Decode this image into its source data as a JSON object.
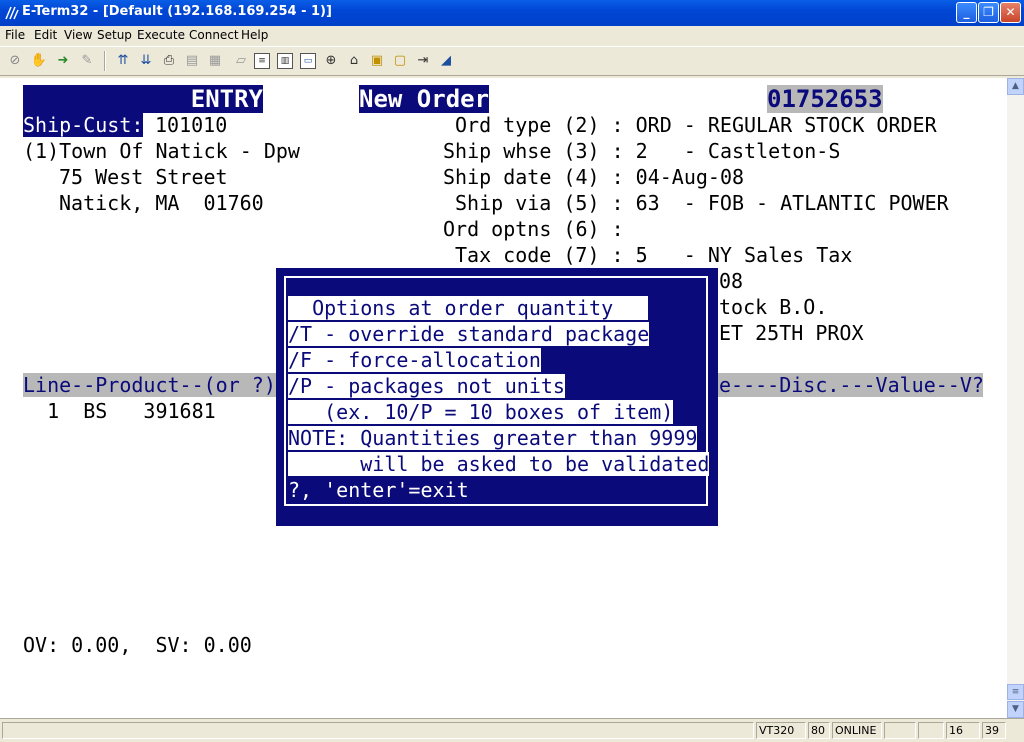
{
  "window": {
    "title": "E-Term32 - [Default (192.168.169.254 - 1)]"
  },
  "menu": [
    "File",
    "Edit",
    "View",
    "Setup",
    "Execute",
    "Connect",
    "Help"
  ],
  "toolbar": {
    "icons": [
      "disconnect-icon",
      "hand-icon",
      "connect-icon",
      "stamp-icon",
      "upload-icon",
      "download-icon",
      "print-icon",
      "copy-icon",
      "paste-icon",
      "clear-icon",
      "list-icon",
      "columns-icon",
      "keyboard-icon",
      "crosshair-icon",
      "macro-icon",
      "folder-icon",
      "script-icon",
      "exit-icon",
      "pen-icon"
    ]
  },
  "terminal": {
    "entry_label": "ENTRY",
    "new_order_label": "New Order",
    "order_number": "01752653",
    "ship_cust_label": "Ship-Cust:",
    "ship_cust_value": "101010",
    "cust_name": "(1)Town Of Natick - Dpw",
    "cust_addr1": "75 West Street",
    "cust_addr2": "Natick, MA  01760",
    "fields": [
      "Ord type (2) : ORD - REGULAR STOCK ORDER",
      "Ship whse (3) : 2   - Castleton-S",
      "Ship date (4) : 04-Aug-08",
      "Ship via (5) : 63  - FOB - ATLANTIC POWER",
      "Ord optns (6) :",
      "Tax code (7) : 5   - NY Sales Tax"
    ],
    "hidden_fragment_1": "08",
    "hidden_fragment_2": "tock B.O.",
    "hidden_fragment_3": "ET 25TH PROX",
    "line_header_left": "Line--Product--(or ?)",
    "line_header_right": "e----Disc.---Value--V?",
    "line_row": "  1  BS   391681",
    "totals": "OV: 0.00,  SV: 0.00"
  },
  "popup": {
    "title": "  Options at order quantity",
    "opt_t": "/T - override standard package",
    "opt_f": "/F - force-allocation",
    "opt_p": "/P - packages not units",
    "example": "   (ex. 10/P = 10 boxes of item)",
    "note1": "NOTE: Quantities greater than 9999",
    "note2": "      will be asked to be validated",
    "exit": "?, 'enter'=exit"
  },
  "status": {
    "emulation": "VT320",
    "columns": "80",
    "state": "ONLINE",
    "row": "16",
    "col": "39"
  }
}
